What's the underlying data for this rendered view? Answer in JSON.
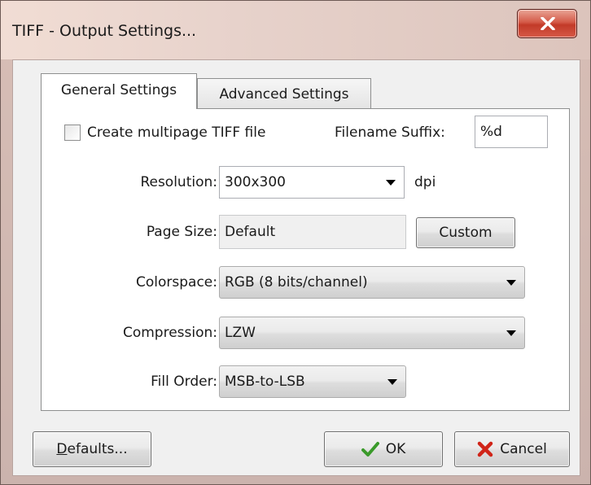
{
  "window": {
    "title": "TIFF - Output Settings..."
  },
  "tabs": [
    {
      "label": "General Settings",
      "active": true
    },
    {
      "label": "Advanced Settings",
      "active": false
    }
  ],
  "general": {
    "multipage": {
      "label": "Create multipage TIFF file",
      "checked": false
    },
    "filename_suffix": {
      "label": "Filename Suffix:",
      "value": "%d"
    },
    "resolution": {
      "label": "Resolution:",
      "value": "300x300",
      "unit": "dpi"
    },
    "page_size": {
      "label": "Page Size:",
      "value": "Default",
      "custom_label": "Custom"
    },
    "colorspace": {
      "label": "Colorspace:",
      "value": "RGB (8 bits/channel)"
    },
    "compression": {
      "label": "Compression:",
      "value": "LZW"
    },
    "fill_order": {
      "label": "Fill Order:",
      "value": "MSB-to-LSB"
    }
  },
  "footer": {
    "defaults_label_underlined": "D",
    "defaults_label_rest": "efaults...",
    "ok_label": "OK",
    "cancel_label": "Cancel"
  },
  "icons": {
    "close": "close-icon",
    "ok": "checkmark-icon",
    "cancel": "red-x-icon"
  },
  "colors": {
    "close_button": "#c94a38",
    "ok_check": "#3a9a2a",
    "cancel_x": "#d02418"
  }
}
